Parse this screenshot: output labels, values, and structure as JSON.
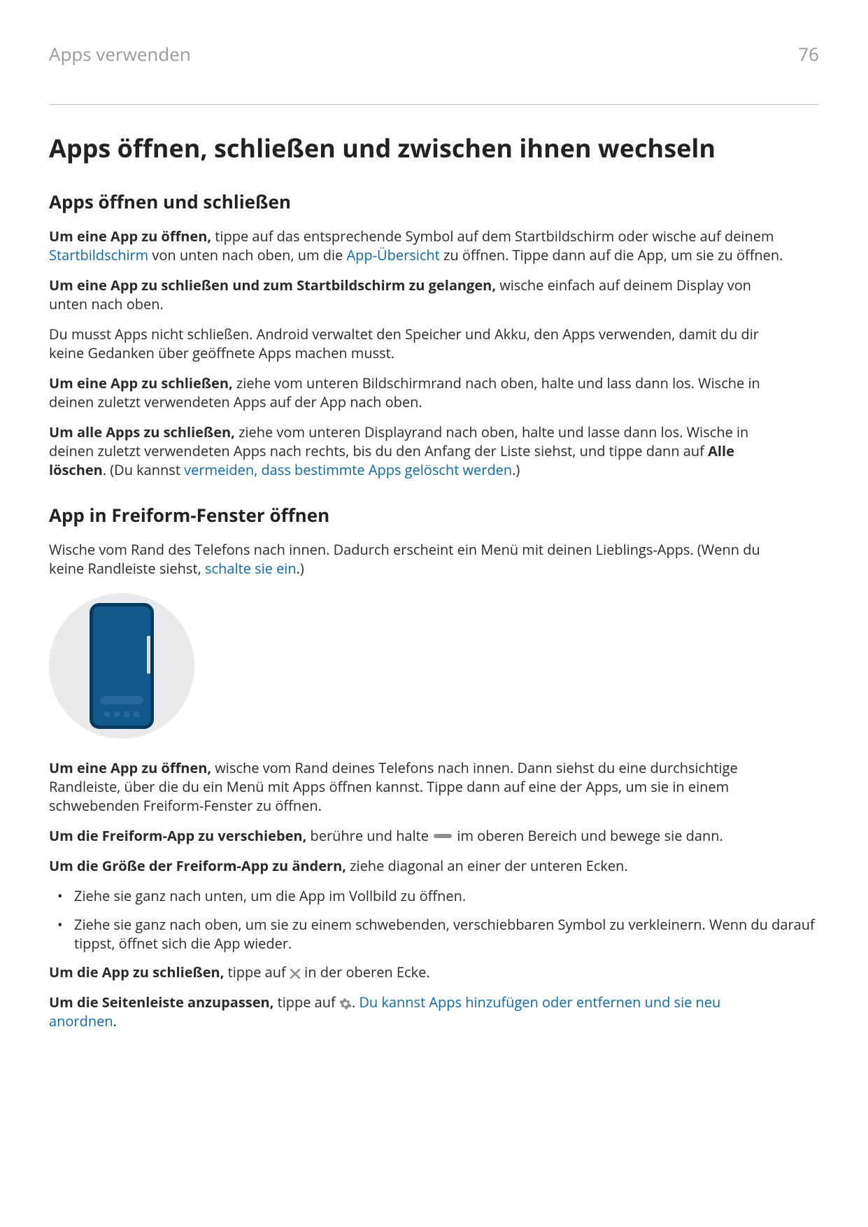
{
  "header": {
    "breadcrumb": "Apps verwenden",
    "page_number": "76"
  },
  "title": "Apps öffnen, schließen und zwischen ihnen wechseln",
  "section1": {
    "heading": "Apps öffnen und schließen",
    "p1_lead": "Um eine App zu öffnen,",
    "p1_a": " tippe auf das entsprechende Symbol auf dem Startbildschirm oder wische auf deinem ",
    "p1_link1": "Startbildschirm",
    "p1_b": " von unten nach oben, um die ",
    "p1_link2": "App-Übersicht",
    "p1_c": " zu öffnen. Tippe dann auf die App, um sie zu öffnen.",
    "p2_lead": "Um eine App zu schließen und zum Startbildschirm zu gelangen,",
    "p2_rest": " wische einfach auf deinem Display von unten nach oben.",
    "p3": "Du musst Apps nicht schließen. Android verwaltet den Speicher und Akku, den Apps verwenden, damit du dir keine Gedanken über geöffnete Apps machen musst.",
    "p4_lead": "Um eine App zu schließen,",
    "p4_rest": " ziehe vom unteren Bildschirmrand nach oben, halte und lass dann los. Wische in deinen zuletzt verwendeten Apps auf der App nach oben.",
    "p5_lead": "Um alle Apps zu schließen,",
    "p5_a": " ziehe vom unteren Displayrand nach oben, halte und lasse dann los. Wische in deinen zuletzt verwendeten Apps nach rechts, bis du den Anfang der Liste siehst, und tippe dann auf ",
    "p5_bold": "Alle löschen",
    "p5_b": ". (Du kannst ",
    "p5_link": "vermeiden, dass bestimmte Apps gelöscht werden",
    "p5_c": ".)"
  },
  "section2": {
    "heading": "App in Freiform-Fenster öffnen",
    "p1_a": "Wische vom Rand des Telefons nach innen. Dadurch erscheint ein Menü mit deinen Lieblings-Apps. (Wenn du keine Randleiste siehst, ",
    "p1_link": "schalte sie ein",
    "p1_b": ".)",
    "p2_lead": "Um eine App zu öffnen,",
    "p2_rest": " wische vom Rand deines Telefons nach innen. Dann siehst du eine durchsichtige Randleiste, über die du ein Menü mit Apps öffnen kannst. Tippe dann auf eine der Apps, um sie in einem schwebenden Freiform-Fenster zu öffnen.",
    "p3_lead": "Um die Freiform-App zu verschieben,",
    "p3_a": " berühre und halte ",
    "p3_b": " im oberen Bereich und bewege sie dann.",
    "p4_lead": "Um die Größe der Freiform-App zu ändern,",
    "p4_rest": " ziehe diagonal an einer der unteren Ecken.",
    "li1": "Ziehe sie ganz nach unten, um die App im Vollbild zu öffnen.",
    "li2": "Ziehe sie ganz nach oben, um sie zu einem schwebenden, verschiebbaren Symbol zu verkleinern. Wenn du darauf tippst, öffnet sich die App wieder.",
    "p5_lead": "Um die App zu schließen,",
    "p5_a": " tippe auf ",
    "p5_b": " in der oberen Ecke.",
    "p6_lead": "Um die Seitenleiste anzupassen,",
    "p6_a": " tippe auf ",
    "p6_b": ". ",
    "p6_link": "Du kannst Apps hinzufügen oder entfernen und sie neu anordnen",
    "p6_c": "."
  }
}
